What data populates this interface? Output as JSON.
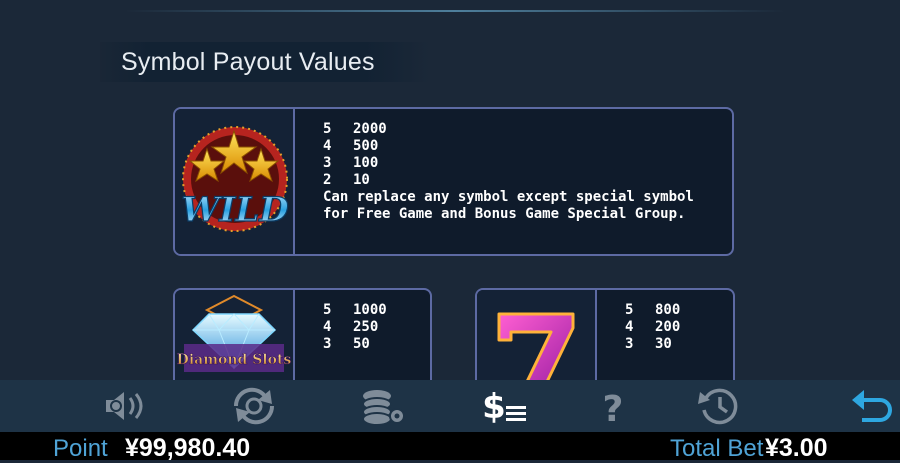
{
  "title": "Symbol Payout Values",
  "symbols": {
    "wild": {
      "icon": "wild-symbol-icon",
      "logo_text": "WILD",
      "payouts": [
        {
          "count": "5",
          "value": "2000"
        },
        {
          "count": "4",
          "value": "500"
        },
        {
          "count": "3",
          "value": "100"
        },
        {
          "count": "2",
          "value": "10"
        }
      ],
      "description": "Can replace any symbol except special symbol for Free Game and Bonus Game Special Group."
    },
    "diamond": {
      "icon": "diamond-slots-symbol-icon",
      "logo_text": "Diamond Slots",
      "payouts": [
        {
          "count": "5",
          "value": "1000"
        },
        {
          "count": "4",
          "value": "250"
        },
        {
          "count": "3",
          "value": "50"
        }
      ]
    },
    "seven": {
      "icon": "seven-symbol-icon",
      "payouts": [
        {
          "count": "5",
          "value": "800"
        },
        {
          "count": "4",
          "value": "200"
        },
        {
          "count": "3",
          "value": "30"
        }
      ]
    }
  },
  "toolbar": [
    "sound-icon",
    "autoplay-icon",
    "chips-settings-icon",
    "paytable-icon",
    "help-icon",
    "history-icon",
    "back-icon"
  ],
  "status": {
    "point_label": "Point",
    "point_value": "¥99,980.40",
    "total_bet_label": "Total Bet",
    "total_bet_value": "¥3.00"
  },
  "colors": {
    "background": "#1b2838",
    "card_border": "#5d6aa3",
    "toolbar_bg": "#1e3346",
    "label_blue": "#4fa3d6",
    "active_icon": "#ffffff",
    "inactive_icon": "#7f8c99",
    "back_icon": "#2ea7e0"
  }
}
